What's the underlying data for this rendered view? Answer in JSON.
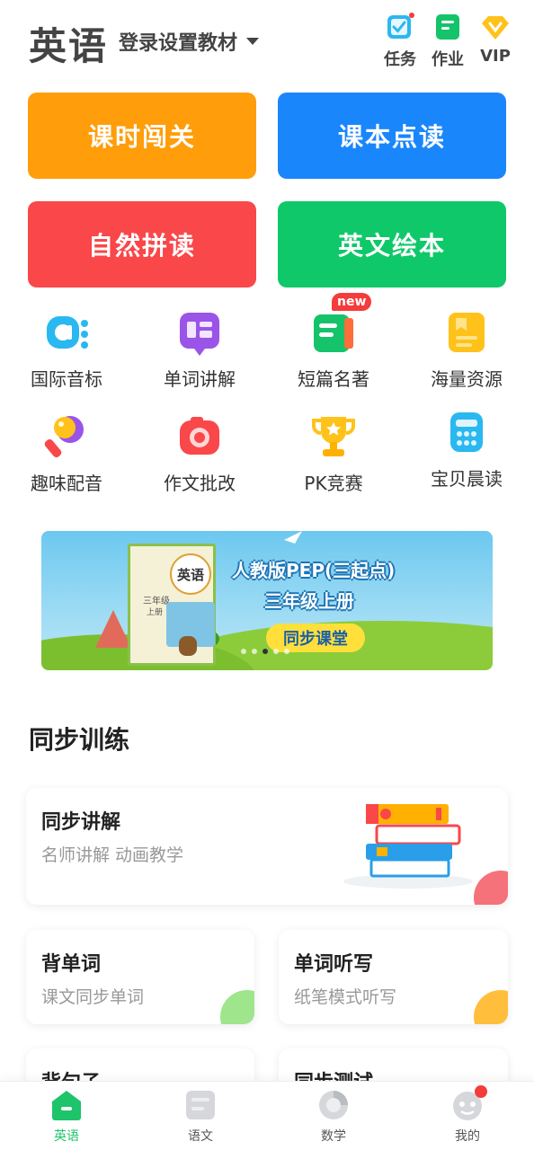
{
  "header": {
    "title": "英语",
    "textbook_setting": "登录设置教材",
    "actions": [
      {
        "label": "任务",
        "icon": "task-check-icon"
      },
      {
        "label": "作业",
        "icon": "homework-icon"
      },
      {
        "label": "VIP",
        "icon": "vip-diamond-icon"
      }
    ]
  },
  "tiles": [
    {
      "label": "课时闯关",
      "color": "#ff9d0a"
    },
    {
      "label": "课本点读",
      "color": "#1a86fb"
    },
    {
      "label": "自然拼读",
      "color": "#f9474a"
    },
    {
      "label": "英文绘本",
      "color": "#0fc86a"
    }
  ],
  "grid": [
    {
      "label": "国际音标",
      "icon": "phonetic-icon"
    },
    {
      "label": "单词讲解",
      "icon": "word-explain-icon"
    },
    {
      "label": "短篇名著",
      "icon": "short-classic-icon",
      "badge": "new"
    },
    {
      "label": "海量资源",
      "icon": "resource-icon"
    },
    {
      "label": "趣味配音",
      "icon": "dubbing-microphone-icon"
    },
    {
      "label": "作文批改",
      "icon": "camera-icon"
    },
    {
      "label": "PK竞赛",
      "icon": "trophy-icon"
    },
    {
      "label": "宝贝晨读",
      "icon": "morning-read-icon"
    }
  ],
  "banner": {
    "book_cover_title": "英语",
    "book_grade": "三年级",
    "book_term": "上册",
    "line1": "人教版PEP(三起点)",
    "line2": "三年级上册",
    "button": "同步课堂",
    "dots_total": 5,
    "dots_active": 3
  },
  "section": {
    "title": "同步训练"
  },
  "cards": [
    {
      "title": "同步讲解",
      "subtitle": "名师讲解  动画教学",
      "accent": "#f5727a"
    },
    {
      "title": "背单词",
      "subtitle": "课文同步单词",
      "accent": "#9ee58c"
    },
    {
      "title": "单词听写",
      "subtitle": "纸笔模式听写",
      "accent": "#ffbe3c"
    },
    {
      "title": "背句子",
      "subtitle": "",
      "accent": "#9ee58c"
    },
    {
      "title": "同步测试",
      "subtitle": "",
      "accent": "#ffbe3c"
    }
  ],
  "bottom_nav": [
    {
      "label": "英语",
      "icon": "english-home-icon",
      "active": true
    },
    {
      "label": "语文",
      "icon": "chinese-book-icon",
      "active": false
    },
    {
      "label": "数学",
      "icon": "math-pie-icon",
      "active": false
    },
    {
      "label": "我的",
      "icon": "profile-face-icon",
      "active": false
    }
  ],
  "colors": {
    "brand_green": "#1ec46a",
    "red_dot": "#f53b3b"
  }
}
